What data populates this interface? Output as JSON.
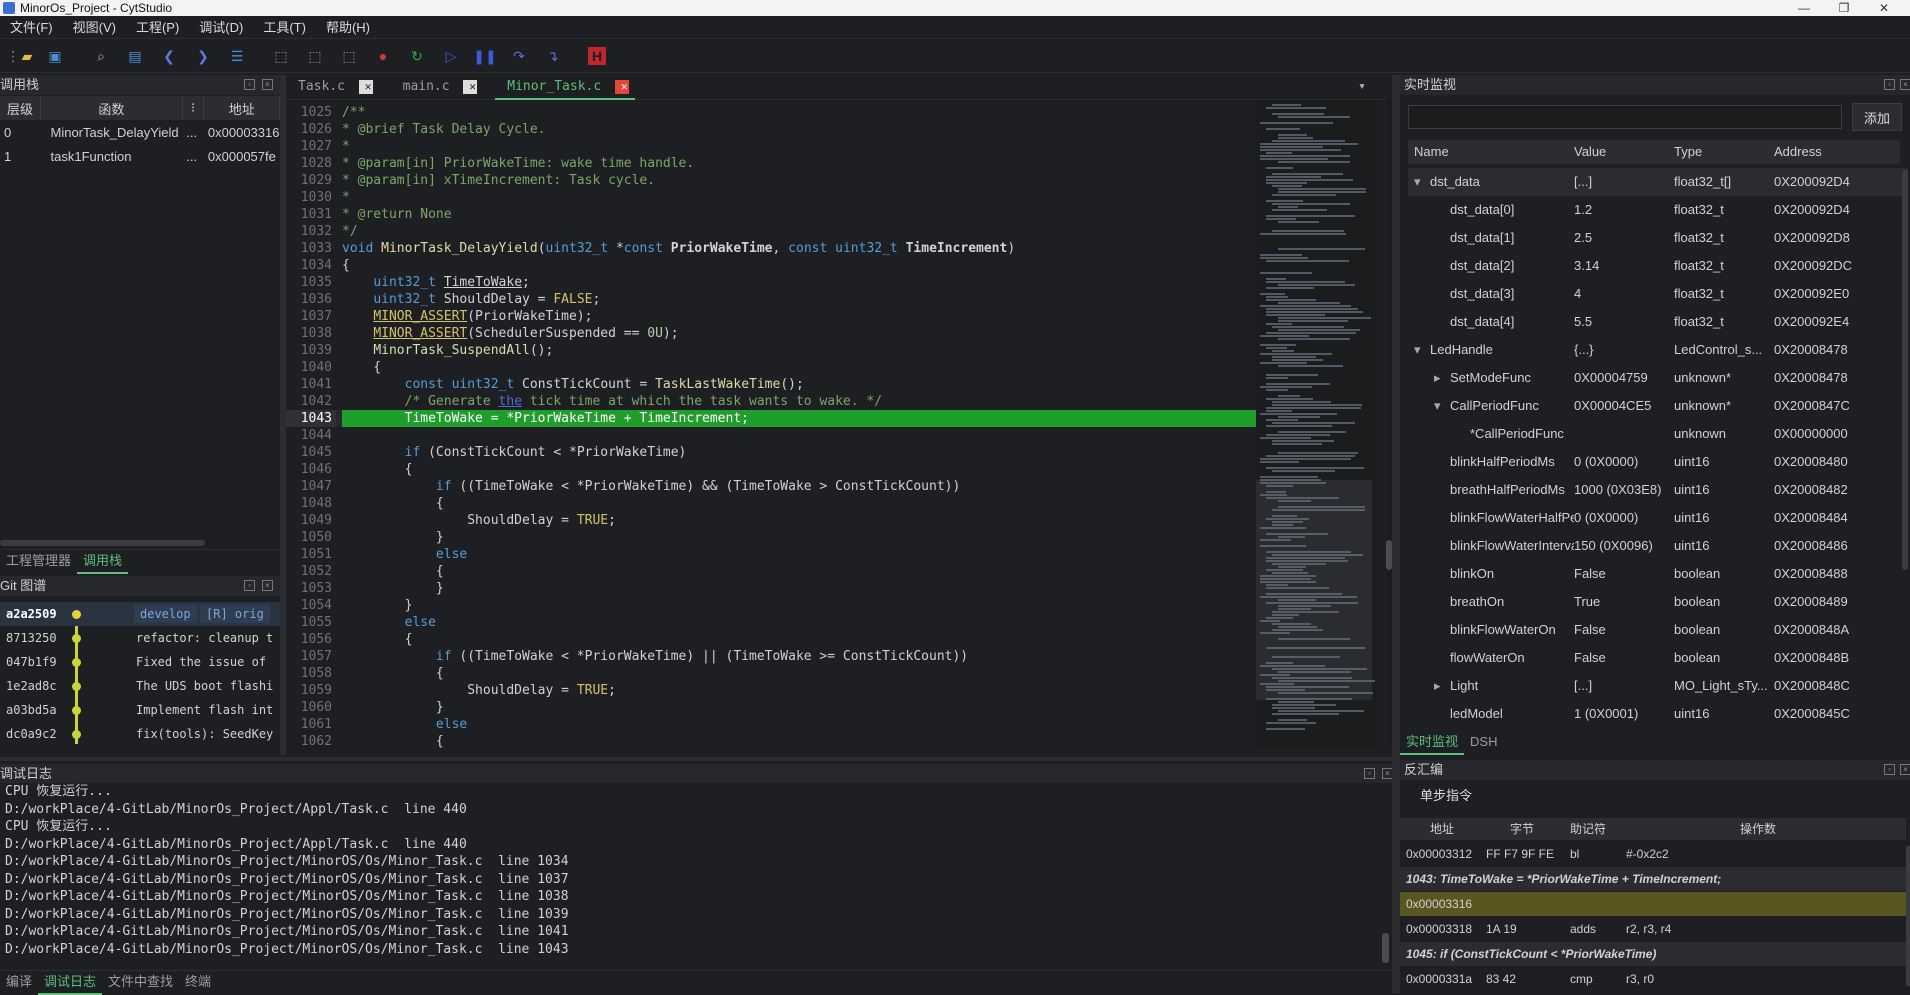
{
  "app": {
    "title": "MinorOs_Project - CytStudio"
  },
  "menu": [
    "文件(F)",
    "视图(V)",
    "工程(P)",
    "调试(D)",
    "工具(T)",
    "帮助(H)"
  ],
  "callstack": {
    "title": "调用栈",
    "headers": [
      "层级",
      "函数",
      "",
      ""
    ],
    "addr_header": "地址",
    "rows": [
      {
        "level": "0",
        "func": "MinorTask_DelayYield",
        "more": "...",
        "addr": "0x00003316"
      },
      {
        "level": "1",
        "func": "task1Function",
        "more": "...",
        "addr": "0x000057fe"
      }
    ]
  },
  "left_tabs": [
    "工程管理器",
    "调用栈"
  ],
  "git": {
    "title": "Git 图谱",
    "rows": [
      {
        "hash": "a2a2509",
        "msg": "",
        "badge1": "develop",
        "badge2": "[R] orig"
      },
      {
        "hash": "8713250",
        "msg": "refactor: cleanup t"
      },
      {
        "hash": "047b1f9",
        "msg": "Fixed the issue of"
      },
      {
        "hash": "1e2ad8c",
        "msg": "The UDS boot flashi"
      },
      {
        "hash": "a03bd5a",
        "msg": "Implement flash int"
      },
      {
        "hash": "dc0a9c2",
        "msg": "fix(tools): SeedKey"
      }
    ]
  },
  "editor": {
    "tabs": [
      "Task.c",
      "main.c",
      "Minor_Task.c"
    ],
    "active_tab": 2,
    "current_line": "1043"
  },
  "debuglog": {
    "title": "调试日志",
    "lines": [
      "CPU 恢复运行...",
      "D:/workPlace/4-GitLab/MinorOs_Project/Appl/Task.c  line 440",
      "CPU 恢复运行...",
      "D:/workPlace/4-GitLab/MinorOs_Project/Appl/Task.c  line 440",
      "D:/workPlace/4-GitLab/MinorOs_Project/MinorOS/Os/Minor_Task.c  line 1034",
      "D:/workPlace/4-GitLab/MinorOs_Project/MinorOS/Os/Minor_Task.c  line 1037",
      "D:/workPlace/4-GitLab/MinorOs_Project/MinorOS/Os/Minor_Task.c  line 1038",
      "D:/workPlace/4-GitLab/MinorOs_Project/MinorOS/Os/Minor_Task.c  line 1039",
      "D:/workPlace/4-GitLab/MinorOs_Project/MinorOS/Os/Minor_Task.c  line 1041",
      "D:/workPlace/4-GitLab/MinorOs_Project/MinorOS/Os/Minor_Task.c  line 1043"
    ]
  },
  "bottom_tabs": [
    "编译",
    "调试日志",
    "文件中查找",
    "终端"
  ],
  "watch": {
    "title": "实时监视",
    "add_label": "添加",
    "headers": [
      "Name",
      "Value",
      "Type",
      "Address"
    ],
    "rows": [
      {
        "name": "dst_data",
        "value": "[...]",
        "type": "float32_t[]",
        "addr": "0X200092D4",
        "ind": 0,
        "arrow": "down"
      },
      {
        "name": "dst_data[0]",
        "value": "1.2",
        "type": "float32_t",
        "addr": "0X200092D4",
        "ind": 1,
        "arrow": ""
      },
      {
        "name": "dst_data[1]",
        "value": "2.5",
        "type": "float32_t",
        "addr": "0X200092D8",
        "ind": 1,
        "arrow": ""
      },
      {
        "name": "dst_data[2]",
        "value": "3.14",
        "type": "float32_t",
        "addr": "0X200092DC",
        "ind": 1,
        "arrow": ""
      },
      {
        "name": "dst_data[3]",
        "value": "4",
        "type": "float32_t",
        "addr": "0X200092E0",
        "ind": 1,
        "arrow": ""
      },
      {
        "name": "dst_data[4]",
        "value": "5.5",
        "type": "float32_t",
        "addr": "0X200092E4",
        "ind": 1,
        "arrow": ""
      },
      {
        "name": "LedHandle",
        "value": "{...}",
        "type": "LedControl_s...",
        "addr": "0X20008478",
        "ind": 0,
        "arrow": "down"
      },
      {
        "name": "SetModeFunc",
        "value": "0X00004759",
        "type": "unknown*",
        "addr": "0X20008478",
        "ind": 1,
        "arrow": "right"
      },
      {
        "name": "CallPeriodFunc",
        "value": "0X00004CE5",
        "type": "unknown*",
        "addr": "0X2000847C",
        "ind": 1,
        "arrow": "down"
      },
      {
        "name": "*CallPeriodFunc",
        "value": "",
        "type": "unknown",
        "addr": "0X00000000",
        "ind": 2,
        "arrow": ""
      },
      {
        "name": "blinkHalfPeriodMs",
        "value": "0 (0X0000)",
        "type": "uint16",
        "addr": "0X20008480",
        "ind": 1,
        "arrow": ""
      },
      {
        "name": "breathHalfPeriodMs",
        "value": "1000 (0X03E8)",
        "type": "uint16",
        "addr": "0X20008482",
        "ind": 1,
        "arrow": ""
      },
      {
        "name": "blinkFlowWaterHalfPer...",
        "value": "0 (0X0000)",
        "type": "uint16",
        "addr": "0X20008484",
        "ind": 1,
        "arrow": ""
      },
      {
        "name": "blinkFlowWaterInterval...",
        "value": "150 (0X0096)",
        "type": "uint16",
        "addr": "0X20008486",
        "ind": 1,
        "arrow": ""
      },
      {
        "name": "blinkOn",
        "value": "False",
        "type": "boolean",
        "addr": "0X20008488",
        "ind": 1,
        "arrow": ""
      },
      {
        "name": "breathOn",
        "value": "True",
        "type": "boolean",
        "addr": "0X20008489",
        "ind": 1,
        "arrow": ""
      },
      {
        "name": "blinkFlowWaterOn",
        "value": "False",
        "type": "boolean",
        "addr": "0X2000848A",
        "ind": 1,
        "arrow": ""
      },
      {
        "name": "flowWaterOn",
        "value": "False",
        "type": "boolean",
        "addr": "0X2000848B",
        "ind": 1,
        "arrow": ""
      },
      {
        "name": "Light",
        "value": "[...]",
        "type": "MO_Light_sTy...",
        "addr": "0X2000848C",
        "ind": 1,
        "arrow": "right"
      },
      {
        "name": "ledModel",
        "value": "1 (0X0001)",
        "type": "uint16",
        "addr": "0X2000845C",
        "ind": 1,
        "arrow": ""
      }
    ]
  },
  "watch_tabs": [
    "实时监视",
    "DSH"
  ],
  "disasm": {
    "title": "反汇编",
    "step_label": "单步指令",
    "headers": [
      "地址",
      "字节",
      "助记符",
      "操作数"
    ],
    "rows": [
      {
        "kind": "ins",
        "addr": "0x00003312",
        "bytes": "FF F7 9F FE",
        "mn": "bl",
        "op": "#-0x2c2"
      },
      {
        "kind": "src",
        "text": "1043:  TimeToWake = *PriorWakeTime + TimeIncrement;"
      },
      {
        "kind": "cur",
        "addr": "0x00003316",
        "bytes": "",
        "mn": "",
        "op": ""
      },
      {
        "kind": "ins",
        "addr": "0x00003318",
        "bytes": "1A 19",
        "mn": "adds",
        "op": "r2, r3, r4"
      },
      {
        "kind": "src",
        "text": "1045:  if (ConstTickCount < *PriorWakeTime)"
      },
      {
        "kind": "ins",
        "addr": "0x0000331a",
        "bytes": "83 42",
        "mn": "cmp",
        "op": "r3, r0"
      }
    ]
  },
  "colors": {
    "accent_green": "#5fbf7a",
    "current_line": "#1f9e2c",
    "disasm_highlight": "#5b5520"
  }
}
